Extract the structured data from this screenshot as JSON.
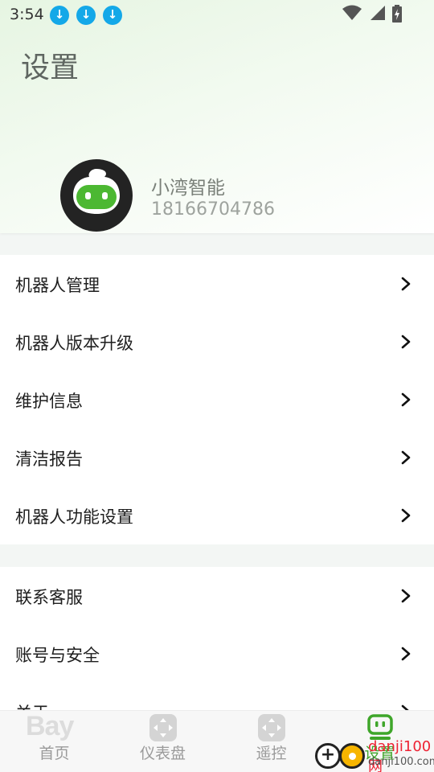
{
  "status_bar": {
    "time": "3:54",
    "notification_icons": [
      "download-icon",
      "download-icon",
      "download-icon"
    ],
    "system_icons": [
      "wifi-icon",
      "cellular-signal-icon",
      "battery-charging-icon"
    ]
  },
  "header": {
    "title": "设置",
    "user": {
      "name": "小湾智能",
      "phone": "18166704786"
    }
  },
  "menu_group_1": [
    {
      "label": "机器人管理"
    },
    {
      "label": "机器人版本升级"
    },
    {
      "label": "维护信息"
    },
    {
      "label": "清洁报告"
    },
    {
      "label": "机器人功能设置"
    }
  ],
  "menu_group_2": [
    {
      "label": "联系客服"
    },
    {
      "label": "账号与安全"
    },
    {
      "label": "关于"
    }
  ],
  "bottom_nav": {
    "logo_text": "Bay",
    "items": [
      {
        "label": "首页",
        "icon": "home-icon",
        "active": false
      },
      {
        "label": "仪表盘",
        "icon": "dashboard-icon",
        "active": false
      },
      {
        "label": "遥控",
        "icon": "remote-control-icon",
        "active": false
      },
      {
        "label": "设置",
        "icon": "robot-settings-icon",
        "active": true
      }
    ]
  },
  "watermark": {
    "text": "danji100网",
    "url_text": "danji100.com"
  },
  "colors": {
    "accent": "#3fa62a",
    "download_badge": "#14a8e8",
    "header_gradient_start": "#e6f5e2"
  }
}
